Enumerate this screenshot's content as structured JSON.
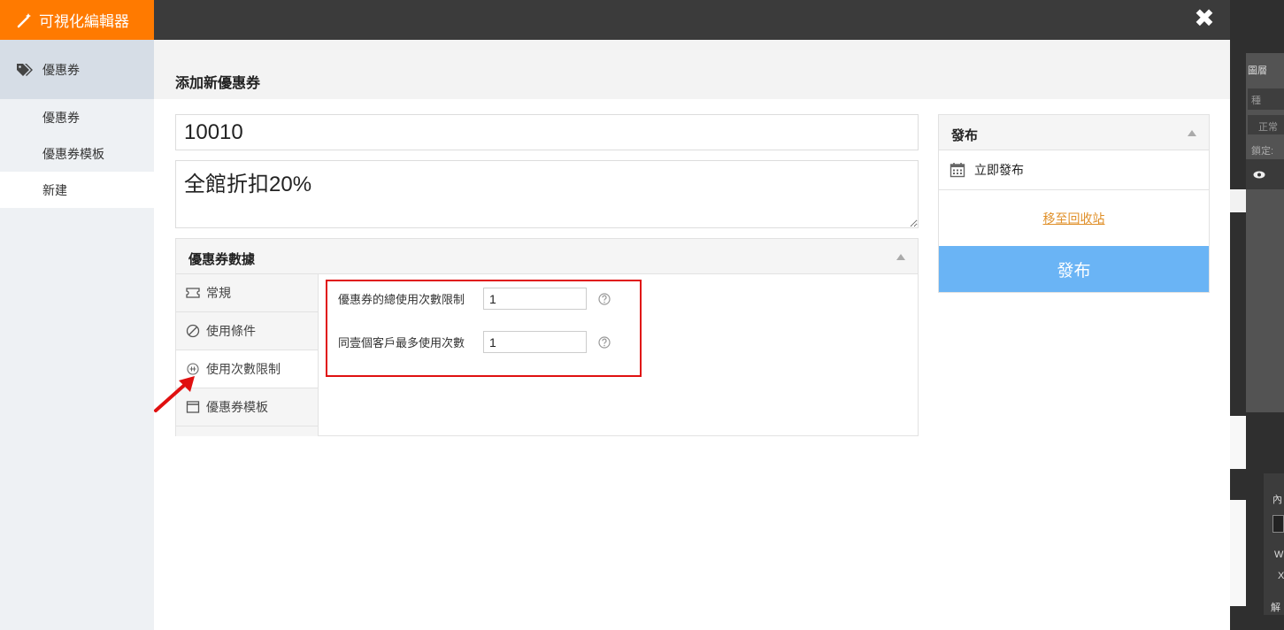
{
  "app": {
    "title": "可視化編輯器",
    "close_symbol": "✖"
  },
  "sidebar": {
    "group_label": "優惠券",
    "items": [
      {
        "label": "優惠券"
      },
      {
        "label": "優惠券模板"
      },
      {
        "label": "新建"
      }
    ]
  },
  "page": {
    "title": "添加新優惠券"
  },
  "form": {
    "code_value": "10010",
    "description_value": "全館折扣20%"
  },
  "coupon_data": {
    "title": "優惠券數據",
    "tabs": [
      {
        "label": "常規",
        "icon": "ticket-icon"
      },
      {
        "label": "使用條件",
        "icon": "ban-icon"
      },
      {
        "label": "使用次數限制",
        "icon": "counter-icon"
      },
      {
        "label": "優惠券模板",
        "icon": "template-icon"
      }
    ],
    "fields": [
      {
        "label": "優惠券的總使用次數限制",
        "value": "1"
      },
      {
        "label": "同壹個客戶最多使用次數",
        "value": "1"
      }
    ]
  },
  "publish": {
    "title": "發布",
    "publish_now": "立即發布",
    "trash_link": "移至回收站",
    "button": "發布"
  },
  "background_app": {
    "tab_label": "圖層",
    "search_placeholder": "種",
    "mode_label": "正常",
    "lock_label": "鎖定:",
    "inner_label": "內",
    "w_label": "W",
    "x_label": "X",
    "resolve_label": "解"
  },
  "colors": {
    "brand": "#ff7a00",
    "publish_button": "#6ab4f5",
    "link": "#e0902a",
    "highlight": "#e01010"
  }
}
